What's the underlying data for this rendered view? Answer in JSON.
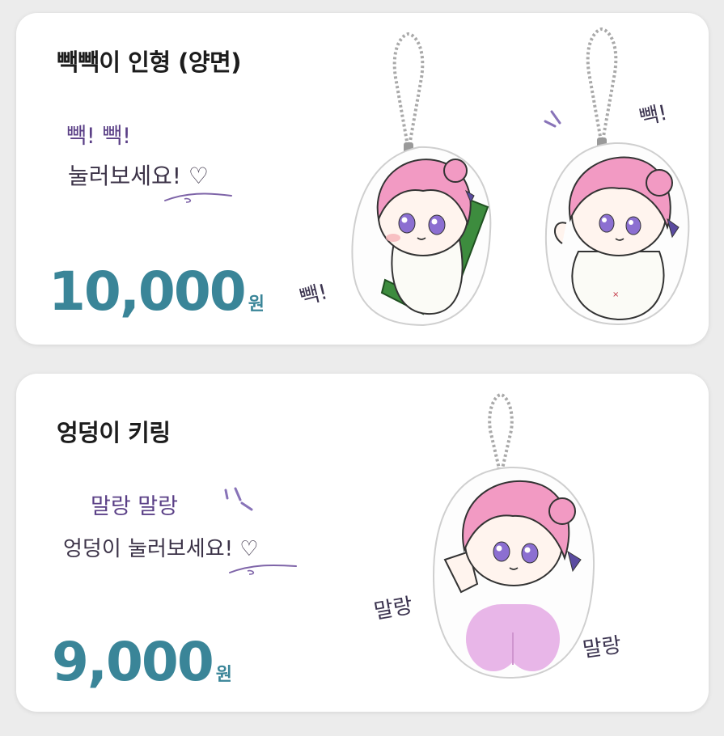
{
  "products": [
    {
      "title": "빽빽이 인형 (양면)",
      "tagline_1": "빽!  빽!",
      "tagline_2": "눌러보세요! ♡",
      "price_number": "10,000",
      "price_unit": "원",
      "sfx_front": "빽!",
      "sfx_back": "빽!"
    },
    {
      "title": "엉덩이 키링",
      "tagline_1": "말랑 말랑",
      "tagline_2": "엉덩이 눌러보세요! ♡",
      "price_number": "9,000",
      "price_unit": "원",
      "sfx_left": "말랑",
      "sfx_right": "말랑"
    }
  ],
  "colors": {
    "price": "#3a8598",
    "hair": "#f29ac3",
    "squishy": "#e8b6e8",
    "leek": "#3d8c3e"
  }
}
